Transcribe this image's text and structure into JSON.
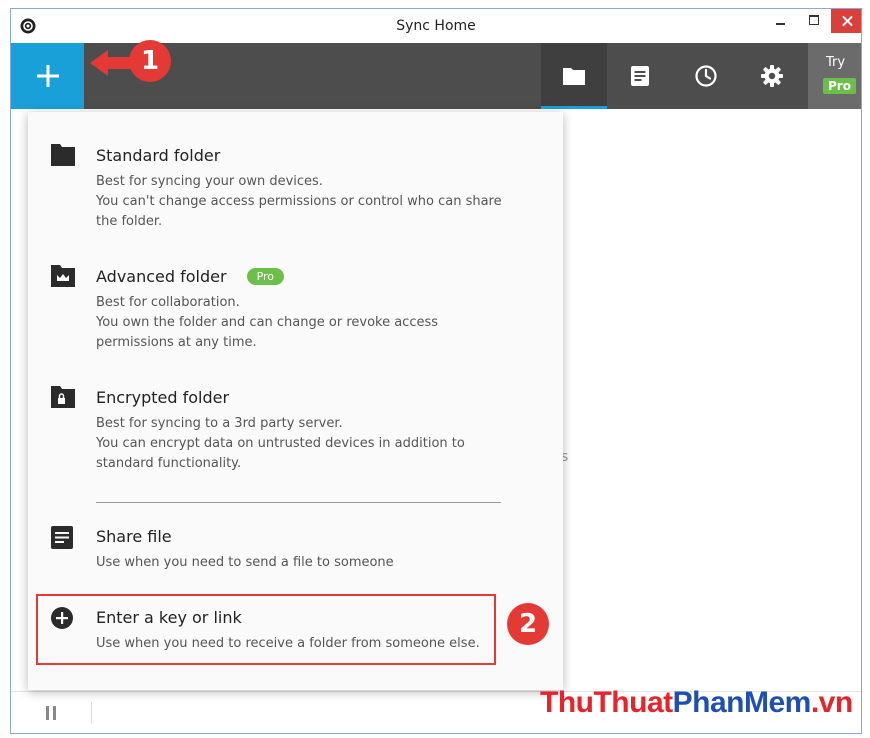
{
  "window": {
    "title": "Sync Home"
  },
  "toolbar": {
    "add_icon": "plus-icon",
    "tabs": [
      {
        "icon": "folder-icon"
      },
      {
        "icon": "document-icon"
      },
      {
        "icon": "clock-icon"
      },
      {
        "icon": "gear-icon"
      }
    ],
    "try_label": "Try",
    "pro_label": "Pro"
  },
  "menu": {
    "items": [
      {
        "title": "Standard folder",
        "icon": "folder-icon",
        "desc_lines": [
          "Best for syncing your own devices.",
          "You can't change access permissions or control who can share",
          "the folder."
        ]
      },
      {
        "title": "Advanced folder",
        "badge": "Pro",
        "icon": "crown-folder-icon",
        "desc_lines": [
          "Best for collaboration.",
          "You own the folder and can change or revoke access",
          "permissions at any time."
        ]
      },
      {
        "title": "Encrypted folder",
        "icon": "lock-folder-icon",
        "desc_lines": [
          "Best for syncing to a 3rd party server.",
          "You can encrypt data on untrusted devices in addition to",
          "standard functionality."
        ]
      },
      {
        "title": "Share file",
        "icon": "document-icon",
        "desc_lines": [
          "Use when you need to send a file to someone"
        ]
      },
      {
        "title": "Enter a key or link",
        "icon": "plus-circle-icon",
        "desc_lines": [
          "Use when you need to receive a folder from someone else."
        ]
      }
    ]
  },
  "annotations": {
    "step1": "1",
    "step2": "2"
  },
  "background_fragment": "s",
  "watermark": {
    "part1": "ThuThuat",
    "part2": "PhanMem",
    "part3": ".vn"
  },
  "colors": {
    "accent": "#1aa0d8",
    "toolbar": "#4d4d4d",
    "pro": "#6cc04a",
    "annotation": "#e53935"
  }
}
